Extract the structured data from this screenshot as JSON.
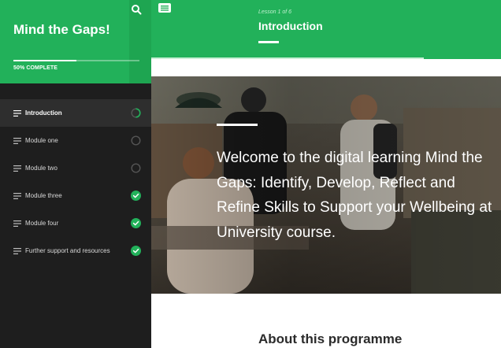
{
  "sidebar": {
    "course_title": "Mind the Gaps!",
    "search_icon": "search-icon",
    "progress": {
      "percent": 50,
      "label": "50% COMPLETE"
    },
    "items": [
      {
        "label": "Introduction",
        "status": "in-progress",
        "active": true
      },
      {
        "label": "Module one",
        "status": "not-started",
        "active": false
      },
      {
        "label": "Module two",
        "status": "not-started",
        "active": false
      },
      {
        "label": "Module three",
        "status": "complete",
        "active": false
      },
      {
        "label": "Module four",
        "status": "complete",
        "active": false
      },
      {
        "label": "Further support and resources",
        "status": "complete",
        "active": false
      }
    ]
  },
  "header": {
    "menu_icon": "hamburger-menu-icon",
    "lesson_counter": "Lesson 1 of 6",
    "lesson_title": "Introduction"
  },
  "hero": {
    "text": "Welcome to the digital learning Mind the Gaps: Identify, Develop, Reflect and Refine Skills to Support your Wellbeing at University course."
  },
  "main": {
    "about_heading": "About this programme"
  },
  "colors": {
    "brand_green": "#22b15a",
    "sidebar_bg": "#1e1e1e",
    "complete_check": "#22b15a"
  }
}
